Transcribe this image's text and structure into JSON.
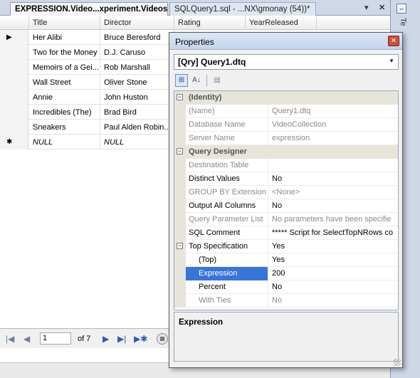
{
  "tabs": {
    "active": "EXPRESSION.Video...xperiment.Videos",
    "inactive": "SQLQuery1.sql - ...NX\\gmonay (54))*",
    "pin_glyph": "▾",
    "close_glyph": "✕"
  },
  "side_panel": {
    "label": "Te",
    "button_glyph": "⇔"
  },
  "grid": {
    "columns": [
      "Title",
      "Director",
      "Rating",
      "YearReleased"
    ],
    "rows": [
      {
        "marker": "▶",
        "title": "Her Alibi",
        "director": "Bruce Beresford"
      },
      {
        "marker": "",
        "title": "Two for the Money",
        "director": "D.J. Caruso"
      },
      {
        "marker": "",
        "title": "Memoirs of a Gei...",
        "director": "Rob Marshall"
      },
      {
        "marker": "",
        "title": "Wall Street",
        "director": "Oliver Stone"
      },
      {
        "marker": "",
        "title": "Annie",
        "director": "John Huston"
      },
      {
        "marker": "",
        "title": "Incredibles (The)",
        "director": "Brad Bird"
      },
      {
        "marker": "",
        "title": "Sneakers",
        "director": "Paul Alden Robin..."
      },
      {
        "marker": "✱",
        "title": "NULL",
        "director": "NULL"
      }
    ]
  },
  "navigation": {
    "first": "|◀",
    "prev": "◀",
    "page": "1",
    "of_total": "of 7",
    "next": "▶",
    "last": "▶|",
    "new": "▶✱"
  },
  "properties": {
    "title": "Properties",
    "close_glyph": "✕",
    "object": "[Qry] Query1.dtq",
    "combo_arrow": "▼",
    "toolbar": {
      "categorized": "⊞",
      "alphabetical": "A↓",
      "pages": "▤"
    },
    "rows": [
      {
        "kind": "cat",
        "toggle": "⊟",
        "label": "(Identity)"
      },
      {
        "kind": "ro",
        "name": "(Name)",
        "value": "Query1.dtq"
      },
      {
        "kind": "ro",
        "name": "Database Name",
        "value": "VideoCollection"
      },
      {
        "kind": "ro",
        "name": "Server Name",
        "value": "expression"
      },
      {
        "kind": "cat",
        "toggle": "⊟",
        "label": "Query Designer"
      },
      {
        "kind": "ro",
        "name": "Destination Table",
        "value": ""
      },
      {
        "kind": "rw",
        "name": "Distinct Values",
        "value": "No"
      },
      {
        "kind": "ro",
        "name": "GROUP BY Extension",
        "value": "<None>"
      },
      {
        "kind": "rw",
        "name": "Output All Columns",
        "value": "No"
      },
      {
        "kind": "ro",
        "name": "Query Parameter List",
        "value": "No parameters have been specifie"
      },
      {
        "kind": "rw",
        "name": "SQL Comment",
        "value": "***** Script for SelectTopNRows co"
      },
      {
        "kind": "rw-toggle",
        "toggle": "⊟",
        "name": "Top Specification",
        "value": "Yes"
      },
      {
        "kind": "sub",
        "name": "(Top)",
        "value": "Yes"
      },
      {
        "kind": "sub-selected",
        "name": "Expression",
        "value": "200"
      },
      {
        "kind": "sub",
        "name": "Percent",
        "value": "No"
      },
      {
        "kind": "sub-ro",
        "name": "With Ties",
        "value": "No"
      }
    ],
    "description_title": "Expression"
  }
}
